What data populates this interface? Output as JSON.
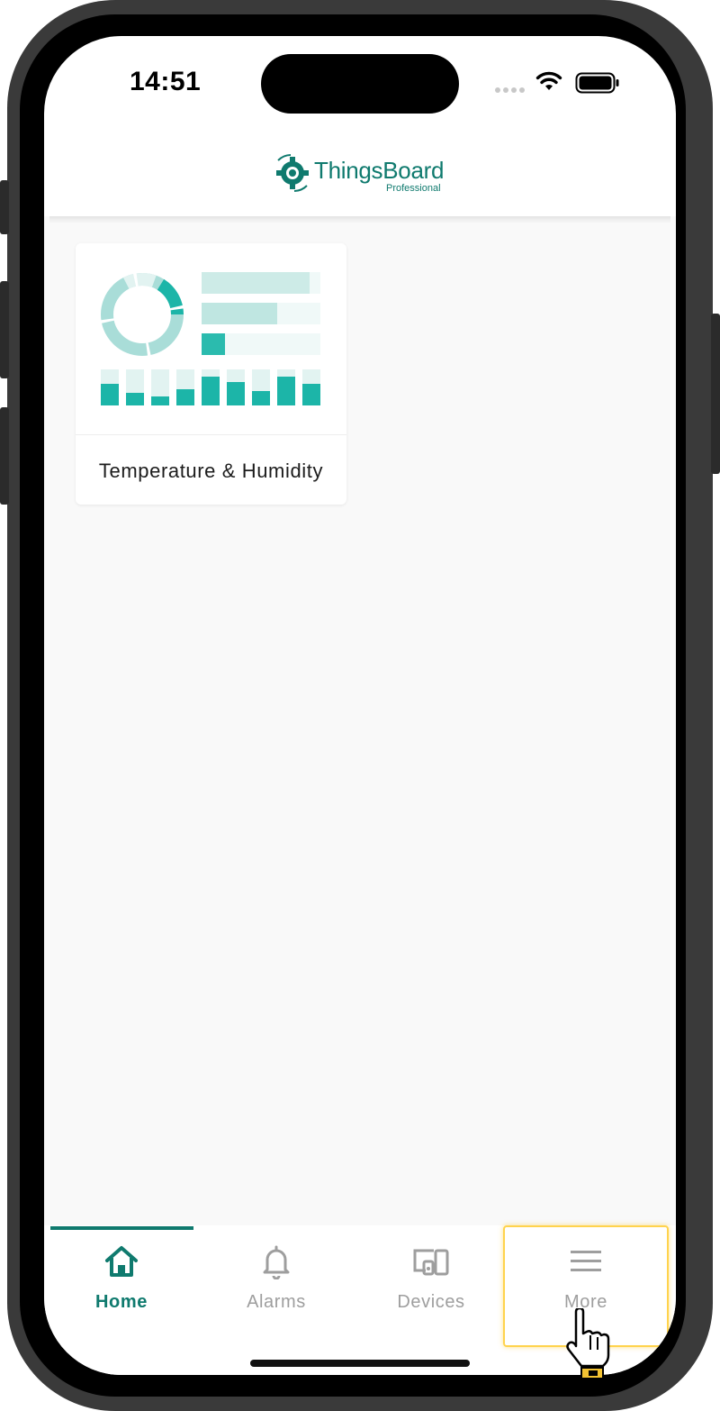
{
  "status_bar": {
    "time": "14:51",
    "icons": [
      "cellular-signal-icon",
      "wifi-icon",
      "battery-icon"
    ]
  },
  "header": {
    "logo_text": "ThingsBoard",
    "logo_subtext": "Professional",
    "logo_icon": "thingsboard-logo-icon"
  },
  "dashboards": [
    {
      "title": "Temperature & Humidity",
      "thumbnail_icon": "dashboard-thumbnail-icon"
    }
  ],
  "bottom_nav": {
    "items": [
      {
        "label": "Home",
        "icon": "home-icon",
        "active": true
      },
      {
        "label": "Alarms",
        "icon": "bell-icon",
        "active": false
      },
      {
        "label": "Devices",
        "icon": "devices-icon",
        "active": false
      },
      {
        "label": "More",
        "icon": "menu-icon",
        "active": false,
        "highlighted": true
      }
    ]
  },
  "colors": {
    "brand": "#0f7a6e",
    "accent_teal": "#1cb5a8",
    "inactive": "#9e9e9e",
    "highlight": "#ffd34d",
    "background": "#f9f9f9"
  }
}
